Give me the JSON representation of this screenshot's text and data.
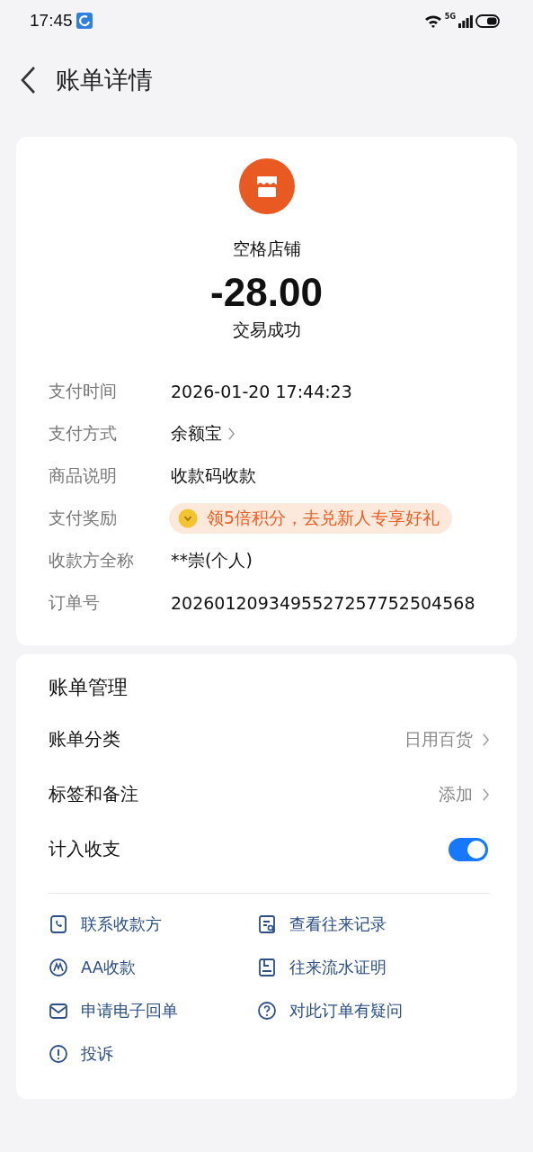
{
  "status_bar": {
    "time": "17:45",
    "network": "5G"
  },
  "header": {
    "title": "账单详情"
  },
  "summary": {
    "merchant": "空格店铺",
    "amount": "-28.00",
    "status": "交易成功"
  },
  "details": [
    {
      "kind": "text",
      "label": "支付时间",
      "value": "2026-01-20 17:44:23"
    },
    {
      "kind": "link",
      "label": "支付方式",
      "value": "余额宝"
    },
    {
      "kind": "text",
      "label": "商品说明",
      "value": "收款码收款"
    },
    {
      "kind": "reward",
      "label": "支付奖励",
      "value": "领5倍积分，去兑新人专享好礼"
    },
    {
      "kind": "text",
      "label": "收款方全称",
      "value": "**崇(个人)"
    },
    {
      "kind": "text",
      "label": "订单号",
      "value": "2026012093495527257752504568"
    }
  ],
  "management": {
    "title": "账单管理",
    "rows": [
      {
        "kind": "link",
        "label": "账单分类",
        "value": "日用百货"
      },
      {
        "kind": "link",
        "label": "标签和备注",
        "value": "添加"
      },
      {
        "kind": "toggle",
        "label": "计入收支",
        "on": true
      }
    ]
  },
  "actions": [
    {
      "label": "联系收款方"
    },
    {
      "label": "查看往来记录"
    },
    {
      "label": "AA收款"
    },
    {
      "label": "往来流水证明"
    },
    {
      "label": "申请电子回单"
    },
    {
      "label": "对此订单有疑问"
    },
    {
      "label": "投诉"
    }
  ]
}
